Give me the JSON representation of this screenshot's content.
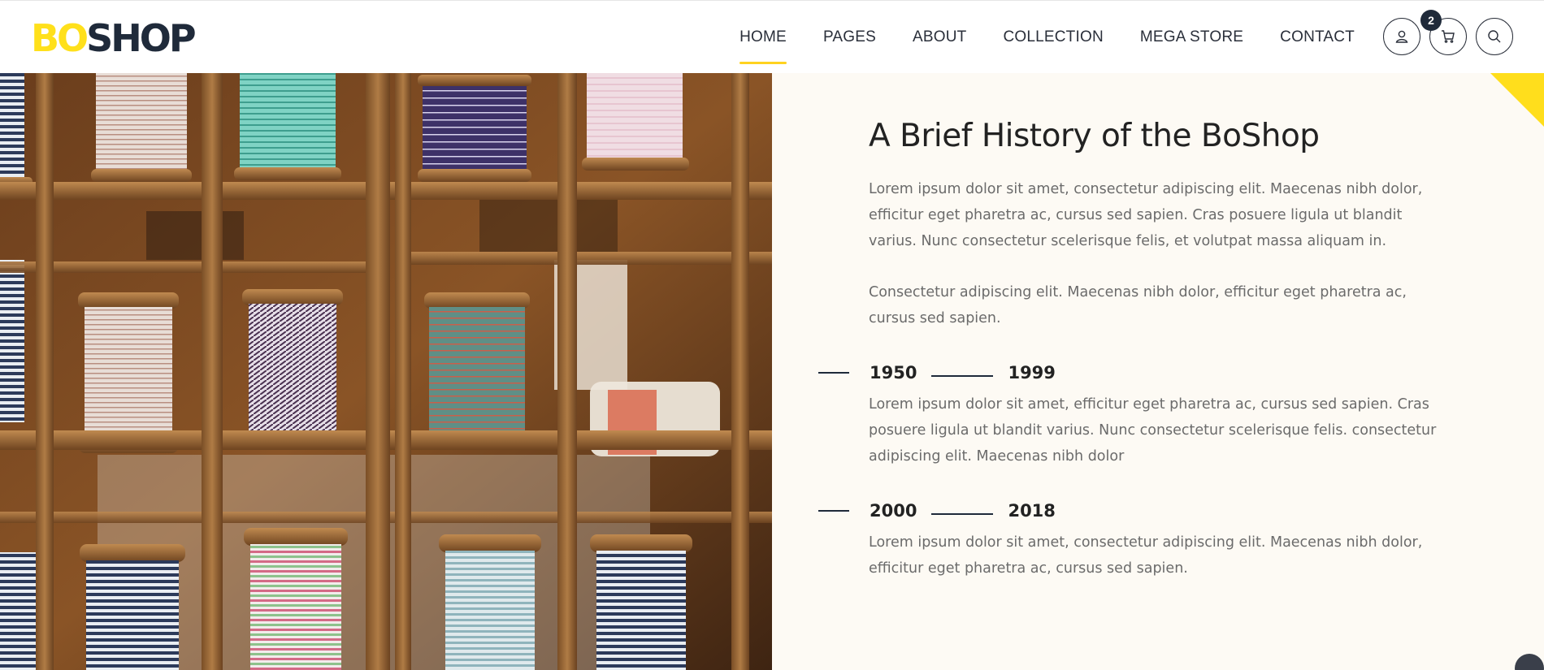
{
  "brand": {
    "logo_part1": "BO",
    "logo_part2": "SHOP"
  },
  "nav": {
    "items": [
      {
        "label": "HOME",
        "active": true
      },
      {
        "label": "PAGES",
        "active": false
      },
      {
        "label": "ABOUT",
        "active": false
      },
      {
        "label": "COLLECTION",
        "active": false
      },
      {
        "label": "MEGA STORE",
        "active": false
      },
      {
        "label": "CONTACT",
        "active": false
      }
    ]
  },
  "header_actions": {
    "user_icon": "user-icon",
    "cart_icon": "cart-icon",
    "cart_count": "2",
    "search_icon": "search-icon"
  },
  "hero_image": {
    "subject": "wooden-shelves-with-ribbon-spools"
  },
  "content": {
    "title": "A Brief History of the BoShop",
    "paragraph1": "Lorem ipsum dolor sit amet, consectetur adipiscing elit. Maecenas nibh dolor, efficitur eget pharetra ac, cursus sed sapien. Cras posuere ligula ut blandit varius. Nunc consectetur scelerisque felis, et volutpat massa aliquam in.",
    "paragraph2": "Consectetur adipiscing elit. Maecenas nibh dolor, efficitur eget pharetra ac, cursus sed sapien.",
    "timeline": [
      {
        "start": "1950",
        "end": "1999",
        "text": "Lorem ipsum dolor sit amet, efficitur eget pharetra ac, cursus sed sapien. Cras posuere ligula ut blandit varius. Nunc consectetur scelerisque felis. consectetur adipiscing elit. Maecenas nibh dolor"
      },
      {
        "start": "2000",
        "end": "2018",
        "text": "Lorem ipsum dolor sit amet, consectetur adipiscing elit. Maecenas nibh dolor, efficitur eget pharetra ac, cursus sed sapien."
      }
    ]
  },
  "colors": {
    "accent_yellow": "#ffde1c",
    "dark_navy": "#1f2a3a",
    "content_bg": "#fdfaf4",
    "body_text": "#6b6b6b"
  }
}
